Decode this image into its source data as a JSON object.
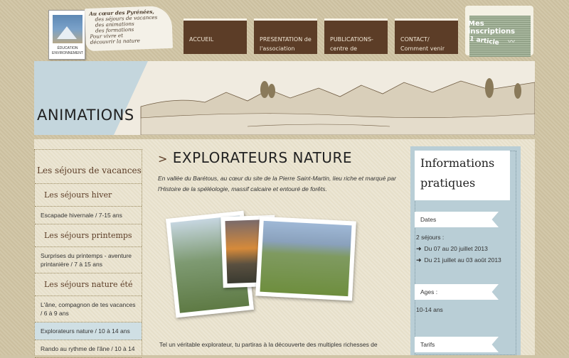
{
  "header": {
    "logo": {
      "text": "ÉDUCATION ENVIRONNEMENT"
    },
    "tagline": [
      "Au cœur des Pyrénées,",
      "des séjours de vacances",
      "des animations",
      "des formations",
      "Pour vivre et",
      "découvrir la nature"
    ]
  },
  "nav": {
    "items": [
      {
        "line1": "ACCUEIL",
        "line2": ""
      },
      {
        "line1": "PRESENTATION de",
        "line2": "l'association"
      },
      {
        "line1": "PUBLICATIONS-",
        "line2": "centre de"
      },
      {
        "line1": "CONTACT/",
        "line2": "Comment venir"
      }
    ]
  },
  "inscriptions": {
    "label": "Mes inscriptions",
    "count": "1 article"
  },
  "banner": {
    "title": "ANIMATIONS"
  },
  "sidebar": {
    "heading": "Les séjours de vacances",
    "sections": [
      {
        "title": "Les séjours hiver",
        "links": [
          "Escapade hivernale / 7-15 ans"
        ]
      },
      {
        "title": "Les séjours printemps",
        "links": [
          "Surprises du printemps - aventure printanière / 7 à 15 ans"
        ]
      },
      {
        "title": "Les séjours nature été",
        "links": [
          "L'âne, compagnon de tes vacances / 6 à 9 ans",
          "Explorateurs nature / 10 à 14 ans",
          "Rando au rythme de l'âne / 10 à 14"
        ]
      }
    ]
  },
  "content": {
    "title_arrow": ">",
    "title": "EXPLORATEURS NATURE",
    "intro": "En vallée du Barétous, au cœur du site de la Pierre Saint-Martin, lieu riche et marqué par l'Histoire de la spéléologie, massif calcaire et entouré de forêts.",
    "bottom_text": "Tel un véritable explorateur, tu partiras à la découverte des multiples richesses de"
  },
  "right": {
    "title_line1": "Informations",
    "title_line2": "pratiques",
    "dates_label": "Dates",
    "dates_intro": "2 séjours :",
    "date1": "Du 07 au 20 juillet  2013",
    "date2": "Du 21 juillet au 03 août 2013",
    "ages_label": "Ages :",
    "ages_value": "10-14 ans",
    "tarifs_label": "Tarifs"
  }
}
